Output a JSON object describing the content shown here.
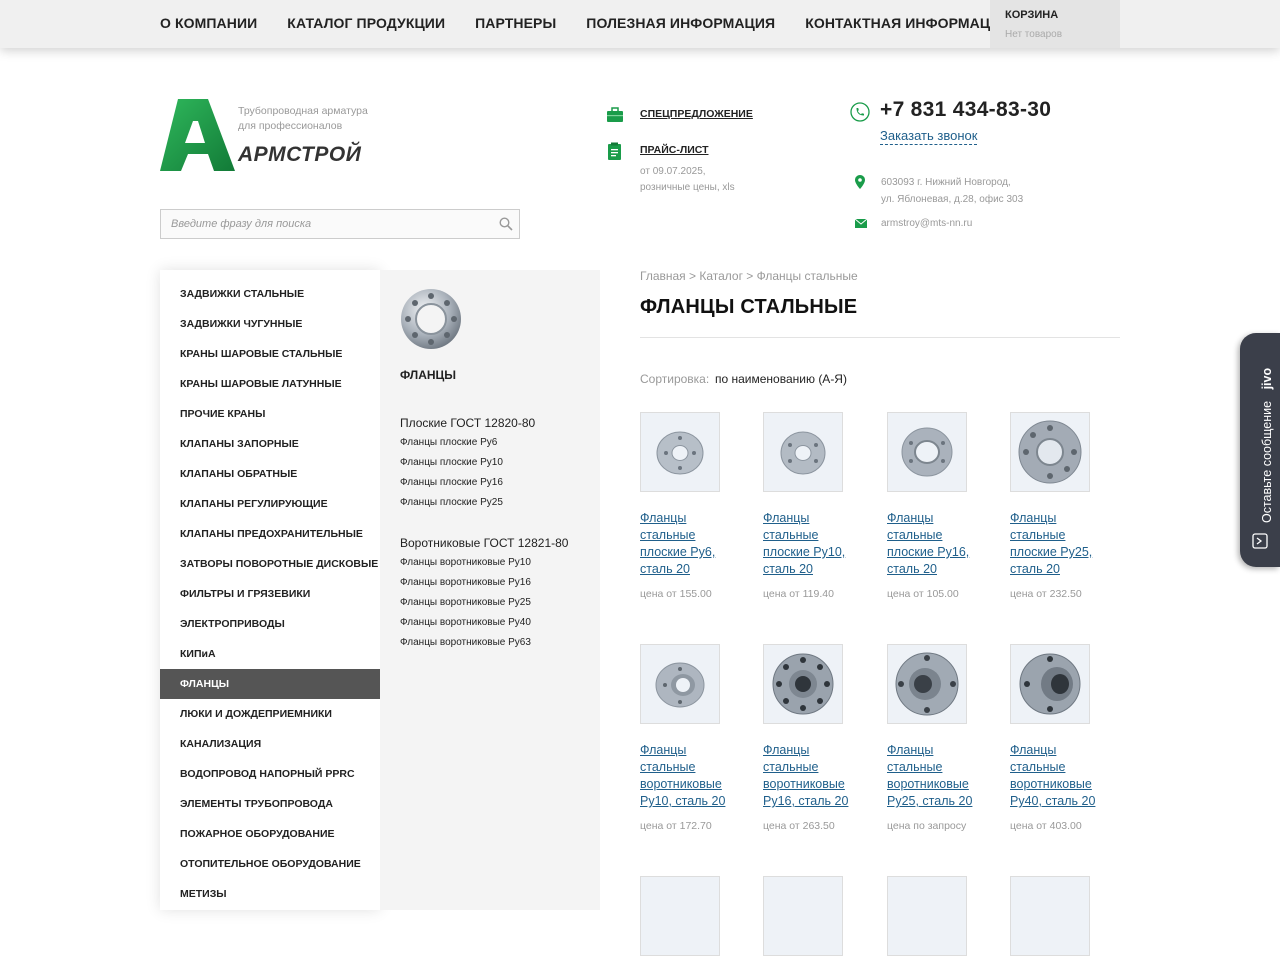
{
  "nav": {
    "items": [
      "О КОМПАНИИ",
      "КАТАЛОГ ПРОДУКЦИИ",
      "ПАРТНЕРЫ",
      "ПОЛЕЗНАЯ ИНФОРМАЦИЯ",
      "КОНТАКТНАЯ ИНФОРМАЦИЯ"
    ]
  },
  "cart": {
    "title": "КОРЗИНА",
    "status": "Нет товаров"
  },
  "header": {
    "tagline_1": "Трубопроводная арматура",
    "tagline_2": "для профессионалов",
    "brand": "АРМСТРОЙ",
    "special_offer": "СПЕЦПРЕДЛОЖЕНИЕ",
    "price_list": "ПРАЙС-ЛИСТ",
    "price_note_1": "от 09.07.2025,",
    "price_note_2": "розничные цены, xls",
    "phone": "+7 831 434-83-30",
    "callback": "Заказать звонок",
    "address_1": "603093 г. Нижний Новгород,",
    "address_2": "ул. Яблоневая, д.28, офис 303",
    "email": "armstroy@mts-nn.ru"
  },
  "search": {
    "placeholder": "Введите фразу для поиска"
  },
  "sidebar": {
    "items": [
      "ЗАДВИЖКИ СТАЛЬНЫЕ",
      "ЗАДВИЖКИ ЧУГУННЫЕ",
      "КРАНЫ ШАРОВЫЕ СТАЛЬНЫЕ",
      "КРАНЫ ШАРОВЫЕ ЛАТУННЫЕ",
      "ПРОЧИЕ КРАНЫ",
      "КЛАПАНЫ ЗАПОРНЫЕ",
      "КЛАПАНЫ ОБРАТНЫЕ",
      "КЛАПАНЫ РЕГУЛИРУЮЩИЕ",
      "КЛАПАНЫ ПРЕДОХРАНИТЕЛЬНЫЕ",
      "ЗАТВОРЫ ПОВОРОТНЫЕ ДИСКОВЫЕ",
      "ФИЛЬТРЫ И ГРЯЗЕВИКИ",
      "ЭЛЕКТРОПРИВОДЫ",
      "КИПиА",
      "ФЛАНЦЫ",
      "ЛЮКИ И ДОЖДЕПРИЕМНИКИ",
      "КАНАЛИЗАЦИЯ",
      "ВОДОПРОВОД НАПОРНЫЙ PPRC",
      "ЭЛЕМЕНТЫ ТРУБОПРОВОДА",
      "ПОЖАРНОЕ ОБОРУДОВАНИЕ",
      "ОТОПИТЕЛЬНОЕ ОБОРУДОВАНИЕ",
      "МЕТИЗЫ"
    ],
    "active": "ФЛАНЦЫ"
  },
  "subpanel": {
    "title": "ФЛАНЦЫ",
    "groups": [
      {
        "title": "Плоские ГОСТ 12820-80",
        "items": [
          "Фланцы плоские Py6",
          "Фланцы плоские Py10",
          "Фланцы плоские Py16",
          "Фланцы плоские Py25"
        ]
      },
      {
        "title": "Воротниковые ГОСТ 12821-80",
        "items": [
          "Фланцы воротниковые Py10",
          "Фланцы воротниковые Py16",
          "Фланцы воротниковые Py25",
          "Фланцы воротниковые Py40",
          "Фланцы воротниковые Py63"
        ]
      }
    ]
  },
  "main": {
    "breadcrumb": "Главная > Каталог > Фланцы стальные",
    "title": "ФЛАНЦЫ СТАЛЬНЫЕ",
    "sort_label": "Сортировка:",
    "sort_value": "по наименованию (А-Я)",
    "products": [
      {
        "name": "Фланцы стальные плоские Py6, сталь 20",
        "price": "цена от 155.00"
      },
      {
        "name": "Фланцы стальные плоские Py10, сталь 20",
        "price": "цена от 119.40"
      },
      {
        "name": "Фланцы стальные плоские Py16, сталь 20",
        "price": "цена от 105.00"
      },
      {
        "name": "Фланцы стальные плоские Py25, сталь 20",
        "price": "цена от 232.50"
      },
      {
        "name": "Фланцы стальные воротниковые Py10, сталь 20",
        "price": "цена от 172.70"
      },
      {
        "name": "Фланцы стальные воротниковые Py16, сталь 20",
        "price": "цена от 263.50"
      },
      {
        "name": "Фланцы стальные воротниковые Py25, сталь 20",
        "price": "цена по запросу"
      },
      {
        "name": "Фланцы стальные воротниковые Py40, сталь 20",
        "price": "цена от 403.00"
      }
    ]
  },
  "jivo": {
    "label": "Оставьте сообщение",
    "brand": "jivo"
  },
  "colors": {
    "accent_green": "#1a9c4a",
    "link_blue": "#1f5f8b",
    "active_menu": "#555555",
    "jivo_bg": "#3b3f4a"
  },
  "icons": [
    "briefcase-icon",
    "clipboard-icon",
    "phone-icon",
    "map-pin-icon",
    "mail-icon",
    "search-icon",
    "chat-icon"
  ]
}
